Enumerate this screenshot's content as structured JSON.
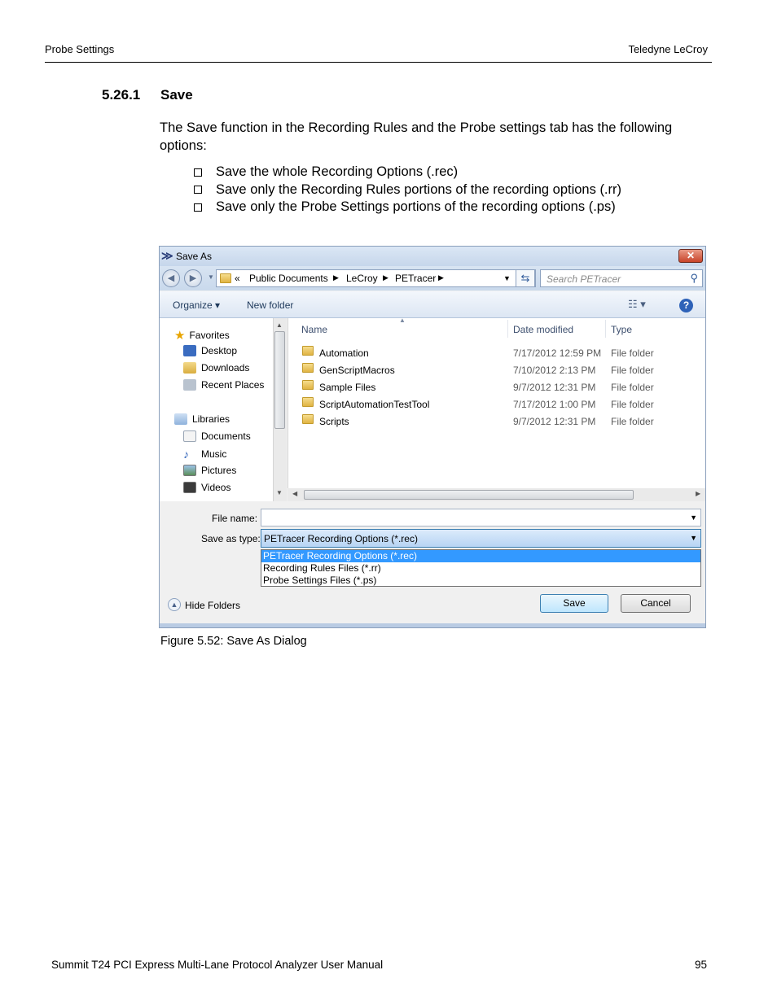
{
  "header": {
    "left": "Probe Settings",
    "right": "Teledyne LeCroy"
  },
  "section": {
    "number": "5.26.1",
    "title": "Save"
  },
  "intro": "The Save function in the Recording Rules and the Probe settings tab has the following options:",
  "bullets": [
    "Save the whole Recording Options (.rec)",
    "Save only the Recording Rules portions of the recording options (.rr)",
    "Save only the Probe Settings portions of the recording options (.ps)"
  ],
  "dialog": {
    "title": "Save As",
    "close_label": "✕",
    "address": {
      "prefix": "«",
      "segments": [
        "Public Documents",
        "LeCroy",
        "PETracer"
      ]
    },
    "search_placeholder": "Search PETracer",
    "toolbar": {
      "organize": "Organize ▾",
      "new_folder": "New folder"
    },
    "nav": {
      "groups": [
        {
          "label": "Favorites",
          "items": [
            "Desktop",
            "Downloads",
            "Recent Places"
          ]
        },
        {
          "label": "Libraries",
          "items": [
            "Documents",
            "Music",
            "Pictures",
            "Videos"
          ]
        }
      ]
    },
    "columns": [
      "Name",
      "Date modified",
      "Type"
    ],
    "files": [
      {
        "name": "Automation",
        "date": "7/17/2012 12:59 PM",
        "type": "File folder"
      },
      {
        "name": "GenScriptMacros",
        "date": "7/10/2012 2:13 PM",
        "type": "File folder"
      },
      {
        "name": "Sample Files",
        "date": "9/7/2012 12:31 PM",
        "type": "File folder"
      },
      {
        "name": "ScriptAutomationTestTool",
        "date": "7/17/2012 1:00 PM",
        "type": "File folder"
      },
      {
        "name": "Scripts",
        "date": "9/7/2012 12:31 PM",
        "type": "File folder"
      }
    ],
    "file_name_label": "File name:",
    "file_name_value": "",
    "save_type_label": "Save as type:",
    "save_type_value": "PETracer Recording Options (*.rec)",
    "type_options": [
      "PETracer Recording Options (*.rec)",
      "Recording Rules Files (*.rr)",
      "Probe Settings Files (*.ps)"
    ],
    "hide_folders": "Hide Folders",
    "save_button": "Save",
    "cancel_button": "Cancel"
  },
  "caption": "Figure 5.52:  Save As Dialog",
  "footer": {
    "left": "Summit T24 PCI Express Multi-Lane Protocol Analyzer User Manual",
    "page": "95"
  }
}
